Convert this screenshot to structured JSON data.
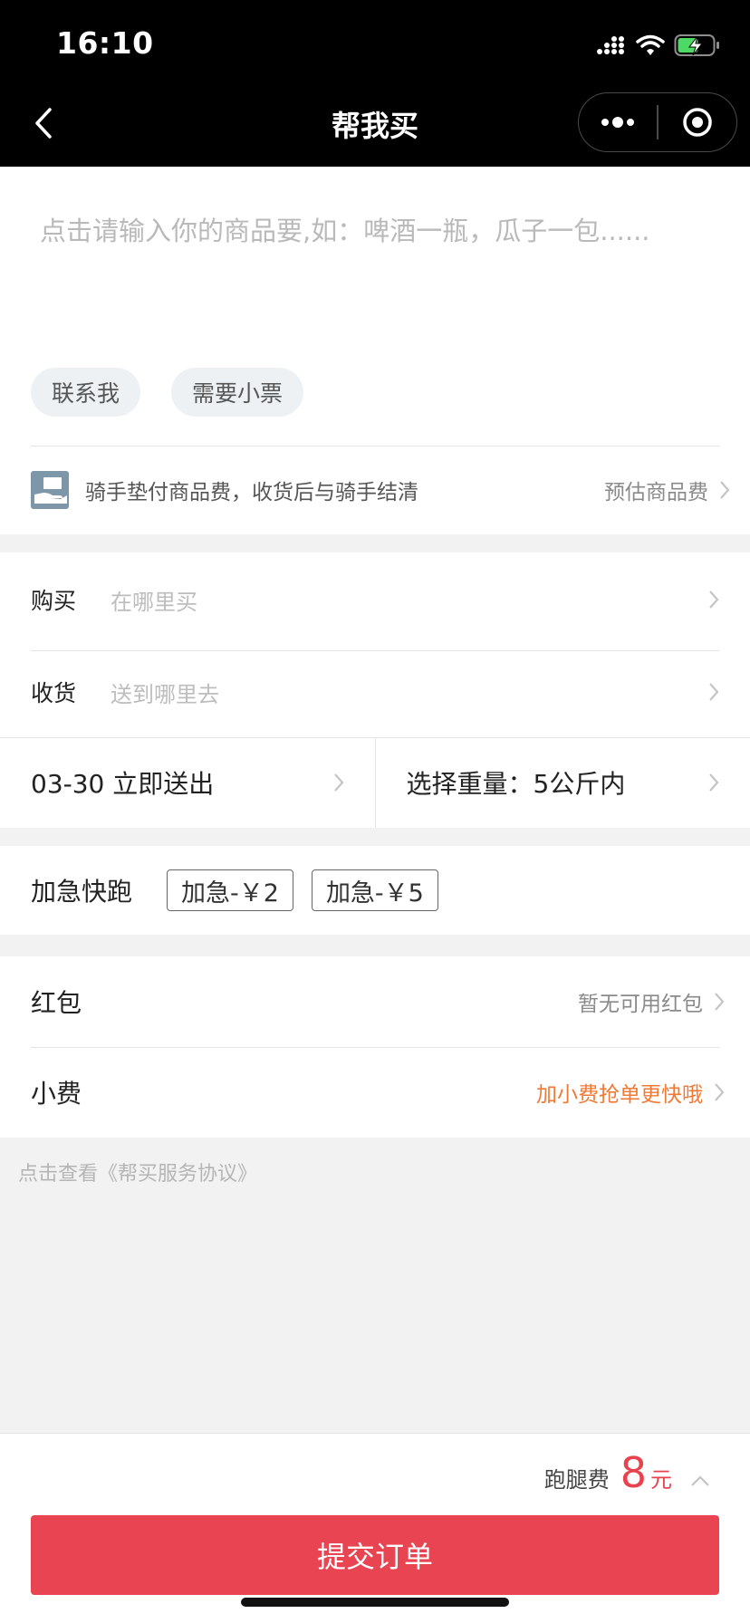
{
  "status_bar": {
    "time": "16:10"
  },
  "nav": {
    "title": "帮我买"
  },
  "goods": {
    "placeholder": "点击请输入你的商品要,如：啤酒一瓶，瓜子一包......",
    "chips": [
      "联系我",
      "需要小票"
    ],
    "prepay_text": "骑手垫付商品费，收货后与骑手结清",
    "prepay_action": "预估商品费"
  },
  "address": {
    "buy_label": "购买",
    "buy_placeholder": "在哪里买",
    "receive_label": "收货",
    "receive_placeholder": "送到哪里去"
  },
  "schedule": {
    "time_text": "03-30 立即送出",
    "weight_text": "选择重量：5公斤内"
  },
  "urgent": {
    "label": "加急快跑",
    "options": [
      "加急-￥2",
      "加急-￥5"
    ]
  },
  "benefits": {
    "red_packet_label": "红包",
    "red_packet_value": "暂无可用红包",
    "tip_label": "小费",
    "tip_value": "加小费抢单更快哦"
  },
  "agreement_text": "点击查看《帮买服务协议》",
  "footer": {
    "fee_label": "跑腿费",
    "fee_amount": "8",
    "fee_unit": "元",
    "submit_label": "提交订单"
  },
  "colors": {
    "accent": "#e94452",
    "tip_orange": "#f07a35",
    "battery_green": "#4cd964"
  },
  "icons": [
    "signal-icon",
    "wifi-icon",
    "battery-charging-icon",
    "back-arrow-icon",
    "more-dots-icon",
    "capsule-close-icon",
    "hand-money-icon",
    "chevron-right-icon",
    "chevron-up-icon"
  ]
}
